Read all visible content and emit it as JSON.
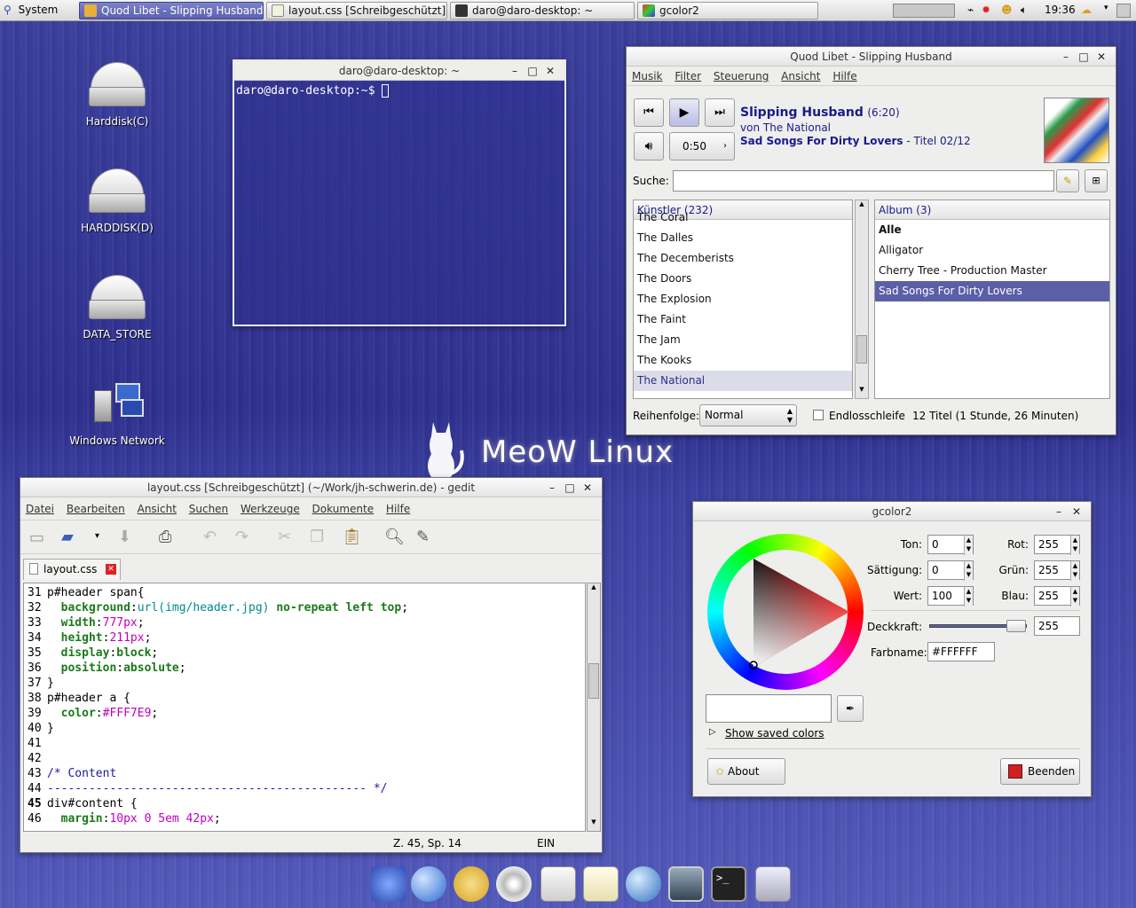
{
  "panel": {
    "system_label": "System",
    "tasks": [
      {
        "label": "Quod Libet - Slipping Husband"
      },
      {
        "label": "layout.css [Schreibgeschützt]..."
      },
      {
        "label": "daro@daro-desktop: ~"
      },
      {
        "label": "gcolor2"
      }
    ],
    "clock": "19:36"
  },
  "desktop": {
    "icons": [
      {
        "label": "Harddisk(C)"
      },
      {
        "label": "HARDDISK(D)"
      },
      {
        "label": "DATA_STORE"
      },
      {
        "label": "Windows Network"
      }
    ],
    "brand": "MeoW Linux"
  },
  "terminal": {
    "title": "daro@daro-desktop: ~",
    "prompt": "daro@daro-desktop:~$ "
  },
  "quodlibet": {
    "title": "Quod Libet - Slipping Husband",
    "menu": [
      "Musik",
      "Filter",
      "Steuerung",
      "Ansicht",
      "Hilfe"
    ],
    "song_title": "Slipping Husband",
    "song_length": "(6:20)",
    "artist_line": "von The National",
    "album_line": "Sad Songs For Dirty Lovers",
    "track_line": " - Titel 02/12",
    "position": "0:50",
    "search_label": "Suche:",
    "artists_header": "Künstler (232)",
    "artists": [
      "The Coral",
      "The Dalles",
      "The Decemberists",
      "The Doors",
      "The Explosion",
      "The Faint",
      "The Jam",
      "The Kooks",
      "The National"
    ],
    "albums_header": "Album (3)",
    "albums": [
      "Alle",
      "Alligator",
      "Cherry Tree - Production Master",
      "Sad Songs For Dirty Lovers"
    ],
    "order_label": "Reihenfolge:",
    "order_value": "Normal",
    "repeat_label": "Endlosschleife",
    "summary": "12 Titel (1 Stunde, 26 Minuten)"
  },
  "gedit": {
    "title": "layout.css [Schreibgeschützt] (~/Work/jh-schwerin.de) - gedit",
    "menu": [
      "Datei",
      "Bearbeiten",
      "Ansicht",
      "Suchen",
      "Werkzeuge",
      "Dokumente",
      "Hilfe"
    ],
    "tab_label": "layout.css",
    "status_pos": "Z. 45, Sp. 14",
    "status_mode": "EIN"
  },
  "gcolor": {
    "title": "gcolor2",
    "hue_label": "Ton:",
    "hue": "0",
    "sat_label": "Sättigung:",
    "sat": "0",
    "val_label": "Wert:",
    "val": "100",
    "red_label": "Rot:",
    "red": "255",
    "green_label": "Grün:",
    "green": "255",
    "blue_label": "Blau:",
    "blue": "255",
    "opacity_label": "Deckkraft:",
    "opacity": "255",
    "name_label": "Farbname:",
    "name": "#FFFFFF",
    "saved_colors": "Show saved colors",
    "about": "About",
    "quit": "Beenden"
  },
  "colors": {
    "desktop_bg": "#2d2f8c",
    "selection": "#5b5fa8",
    "title_accent": "#1a1a8c"
  }
}
